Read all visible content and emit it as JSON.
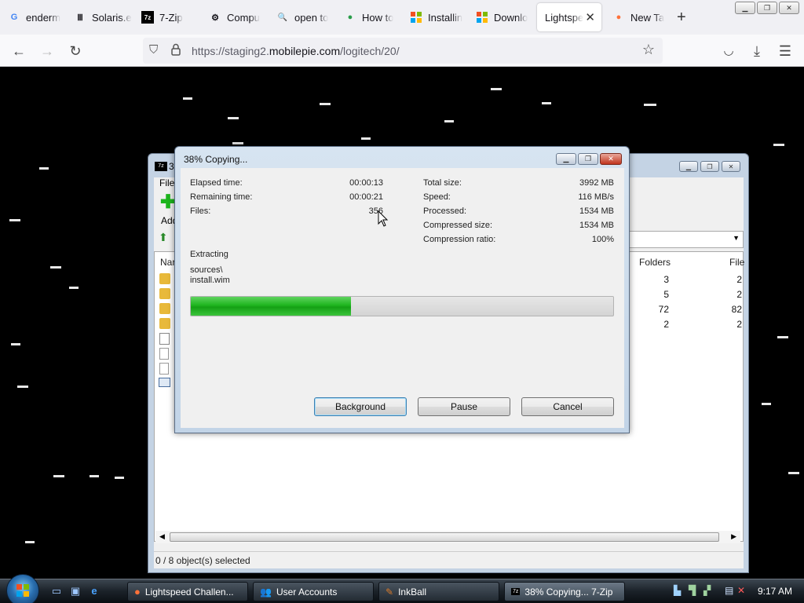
{
  "browser": {
    "tabs": [
      {
        "label": "enderm",
        "icon": "G"
      },
      {
        "label": "Solaris.e",
        "icon": "Ⅲ"
      },
      {
        "label": "7-Zip",
        "icon": "7z"
      },
      {
        "label": "Compu",
        "icon": "⚙"
      },
      {
        "label": "open to",
        "icon": "🔍"
      },
      {
        "label": "How to",
        "icon": "●"
      },
      {
        "label": "Installin",
        "icon": "▦"
      },
      {
        "label": "Downlo",
        "icon": "▦"
      },
      {
        "label": "Lightspe",
        "icon": ""
      },
      {
        "label": "New Ta",
        "icon": "●"
      }
    ],
    "active_tab_close": "✕",
    "new_tab": "+",
    "url_prefix": "https://staging2.",
    "url_domain": "mobilepie.com",
    "url_path": "/logitech/20/"
  },
  "zip_window": {
    "title_fragment": "3",
    "menu_fragment": "File",
    "toolbar_add": "Add",
    "col_name": "Nar",
    "col_folders": "Folders",
    "col_files": "File",
    "rows": [
      {
        "folders": "3",
        "files": "2"
      },
      {
        "folders": "5",
        "files": "2"
      },
      {
        "folders": "72",
        "files": "82"
      },
      {
        "folders": "2",
        "files": "2"
      }
    ],
    "status": "0 / 8 object(s) selected"
  },
  "progress_dialog": {
    "title": "38% Copying...",
    "elapsed_label": "Elapsed time:",
    "elapsed_value": "00:00:13",
    "remaining_label": "Remaining time:",
    "remaining_value": "00:00:21",
    "files_label": "Files:",
    "files_value": "356",
    "total_size_label": "Total size:",
    "total_size_value": "3992 MB",
    "speed_label": "Speed:",
    "speed_value": "116 MB/s",
    "processed_label": "Processed:",
    "processed_value": "1534 MB",
    "compressed_label": "Compressed size:",
    "compressed_value": "1534 MB",
    "ratio_label": "Compression ratio:",
    "ratio_value": "100%",
    "operation": "Extracting",
    "path_line1": "sources\\",
    "path_line2": "install.wim",
    "progress_fraction": 0.38,
    "buttons": {
      "background": "Background",
      "pause": "Pause",
      "cancel": "Cancel"
    }
  },
  "taskbar": {
    "tasks": [
      {
        "label": "Lightspeed Challen...",
        "icon": "firefox-icon"
      },
      {
        "label": "User Accounts",
        "icon": "users-icon"
      },
      {
        "label": "InkBall",
        "icon": "inkball-icon"
      },
      {
        "label": "38% Copying... 7-Zip",
        "icon": "7zip-icon"
      }
    ],
    "clock": "9:17 AM"
  }
}
